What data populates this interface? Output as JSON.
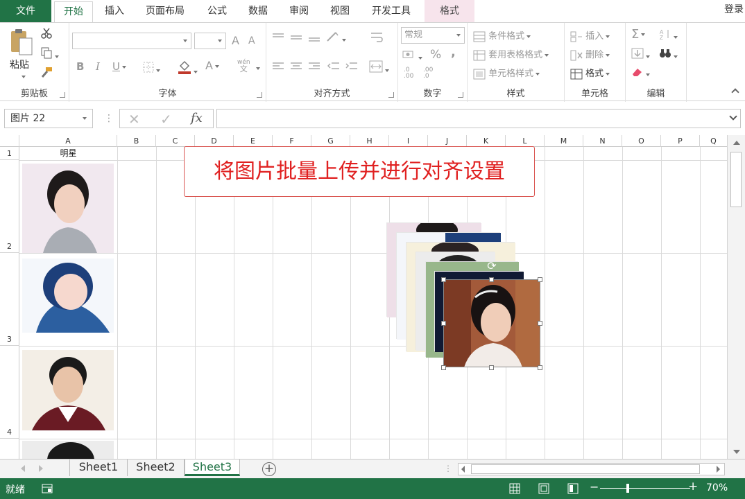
{
  "ribbon_tabs": {
    "file": "文件",
    "home": "开始",
    "insert": "插入",
    "page_layout": "页面布局",
    "formulas": "公式",
    "data": "数据",
    "review": "审阅",
    "view": "视图",
    "developer": "开发工具",
    "format": "格式",
    "login": "登录"
  },
  "ribbon": {
    "clipboard": {
      "label": "剪贴板",
      "paste": "粘贴"
    },
    "font": {
      "label": "字体",
      "bold": "B",
      "italic": "I",
      "underline": "U",
      "font_color": "A",
      "phonetic_top": "wén",
      "phonetic_bottom": "文",
      "grow": "A",
      "shrink": "A"
    },
    "alignment": {
      "label": "对齐方式"
    },
    "number": {
      "label": "数字",
      "format_value": "常规",
      "percent": "%",
      "comma": ",",
      "inc_decimal": ".00",
      "dec_decimal": ".0"
    },
    "styles": {
      "label": "样式",
      "conditional": "条件格式",
      "table_format": "套用表格格式",
      "cell_styles": "单元格样式"
    },
    "cells": {
      "label": "单元格",
      "insert": "插入",
      "delete": "删除",
      "format": "格式"
    },
    "editing": {
      "label": "编辑",
      "sum": "Σ"
    }
  },
  "formula_bar": {
    "name_box": "图片 22",
    "cancel": "✕",
    "enter": "✓",
    "fx": "fx",
    "separator": "⋮",
    "content": ""
  },
  "sheet": {
    "columns": [
      "A",
      "B",
      "C",
      "D",
      "E",
      "F",
      "G",
      "H",
      "I",
      "J",
      "K",
      "L",
      "M",
      "N",
      "O",
      "P",
      "Q"
    ],
    "rows": [
      "1",
      "2",
      "3",
      "4"
    ],
    "a1": "明星",
    "title_box": "将图片批量上传并进行对齐设置"
  },
  "sheet_tabs": [
    "Sheet1",
    "Sheet2",
    "Sheet3"
  ],
  "active_sheet": "Sheet3",
  "add_sheet": "+",
  "status": {
    "ready": "就绪",
    "zoom": "70%",
    "zoom_minus": "−",
    "zoom_plus": "+"
  },
  "colors": {
    "excel_green": "#217346",
    "title_red": "#e02020",
    "context_tab": "#f7e4ec"
  }
}
